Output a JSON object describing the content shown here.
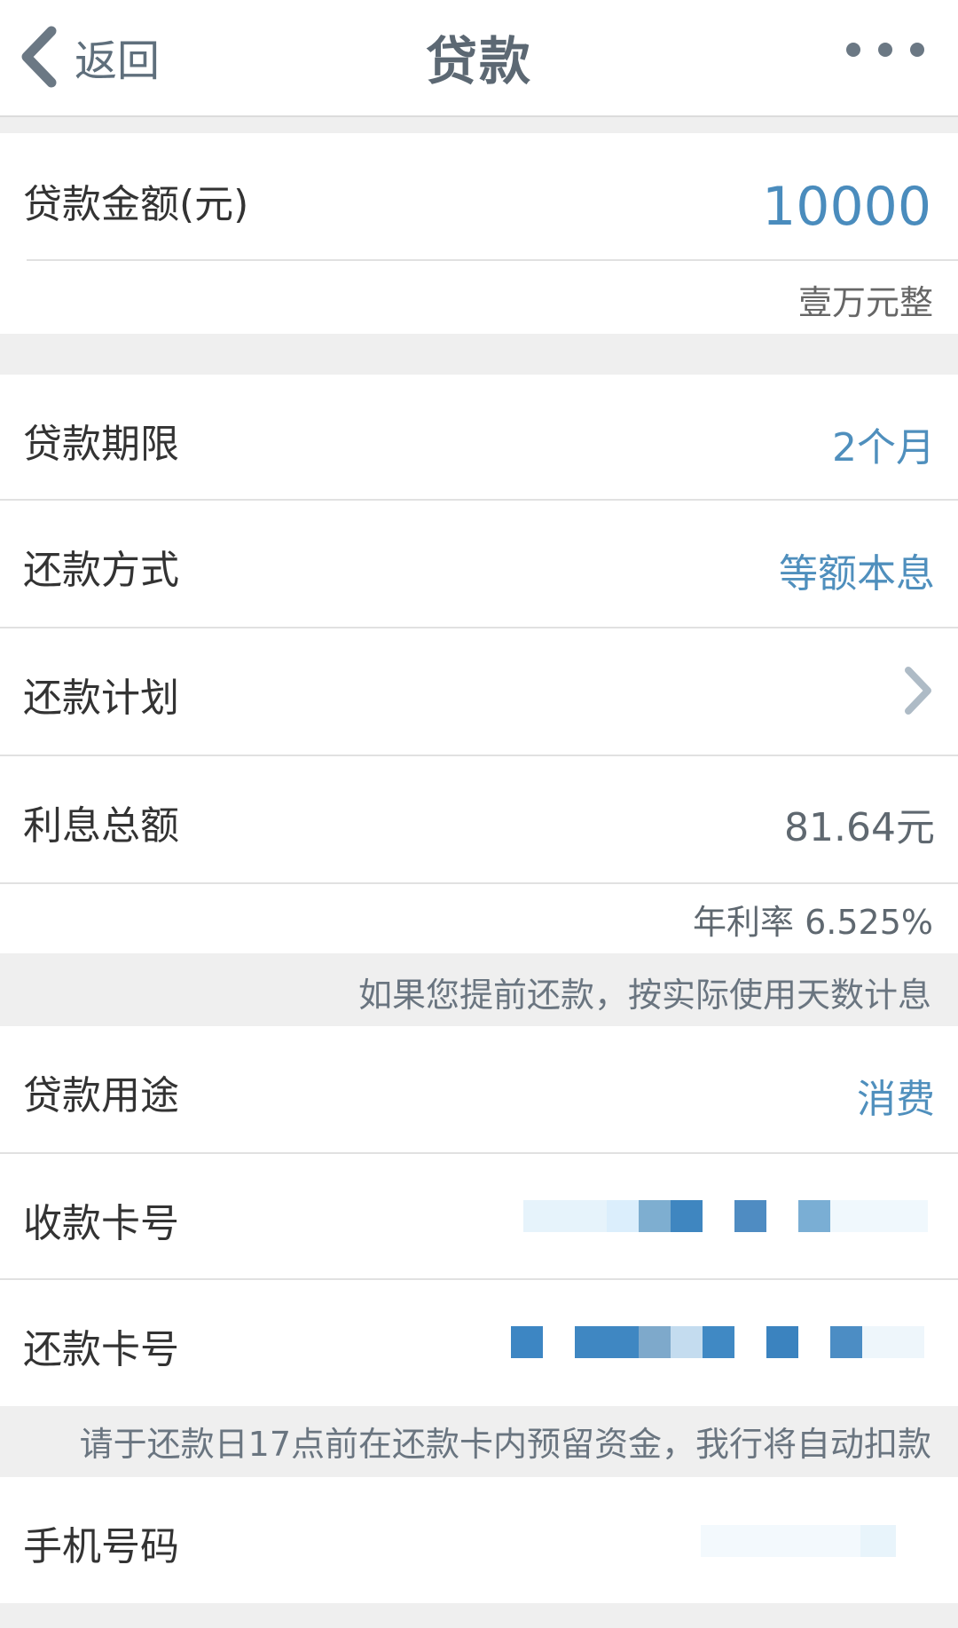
{
  "nav": {
    "back_label": "返回",
    "title": "贷款",
    "back_icon": "chevron-left-icon",
    "more_icon": "more-dots-icon"
  },
  "loan": {
    "amount_label": "贷款金额(元)",
    "amount_value": "10000",
    "amount_uppercase": "壹万元整"
  },
  "rows": {
    "term_label": "贷款期限",
    "term_value": "2个月",
    "method_label": "还款方式",
    "method_value": "等额本息",
    "plan_label": "还款计划",
    "interest_label": "利息总额",
    "interest_value": "81.64元",
    "rate_text": "年利率 6.525%",
    "early_notice": "如果您提前还款，按实际使用天数计息",
    "purpose_label": "贷款用途",
    "purpose_value": "消费",
    "receive_card_label": "收款卡号",
    "repay_card_label": "还款卡号",
    "deduct_notice": "请于还款日17点前在还款卡内预留资金，我行将自动扣款",
    "phone_label": "手机号码"
  },
  "colors": {
    "accent": "#4f8fbd",
    "title": "#5c6873",
    "background": "#efefef"
  }
}
